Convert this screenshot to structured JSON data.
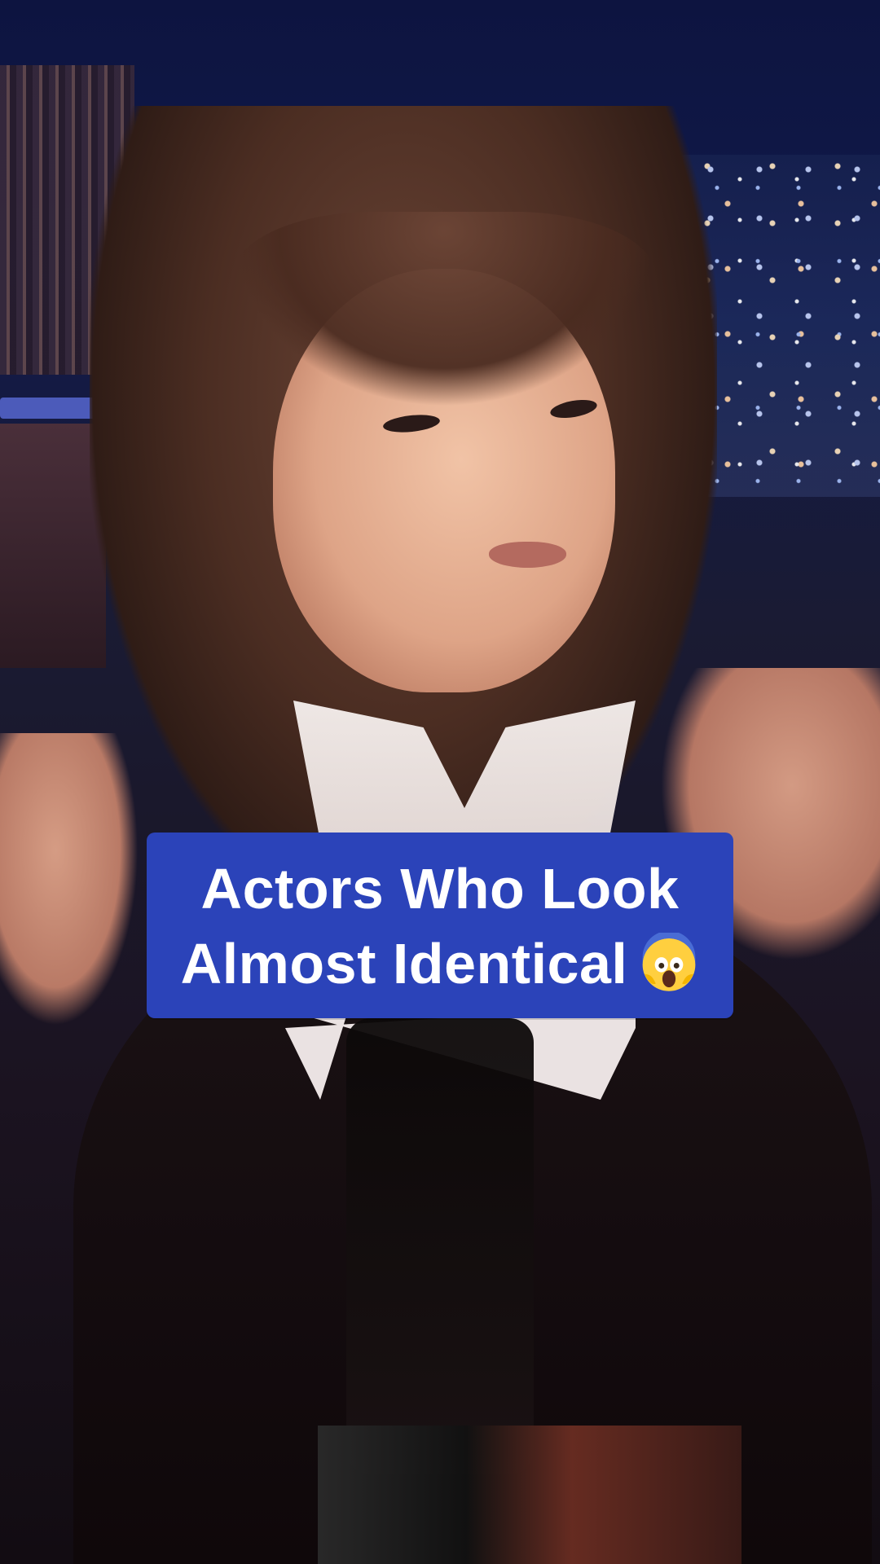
{
  "caption": {
    "line1": "Actors Who Look",
    "line2": "Almost Identical",
    "emoji": "😱",
    "emoji_name": "face-screaming-in-fear-icon",
    "background_color": "#2B43B9",
    "text_color": "#FFFFFF"
  },
  "scene": {
    "background_palette": [
      "#0D1440",
      "#1A1B33",
      "#120C12"
    ]
  }
}
